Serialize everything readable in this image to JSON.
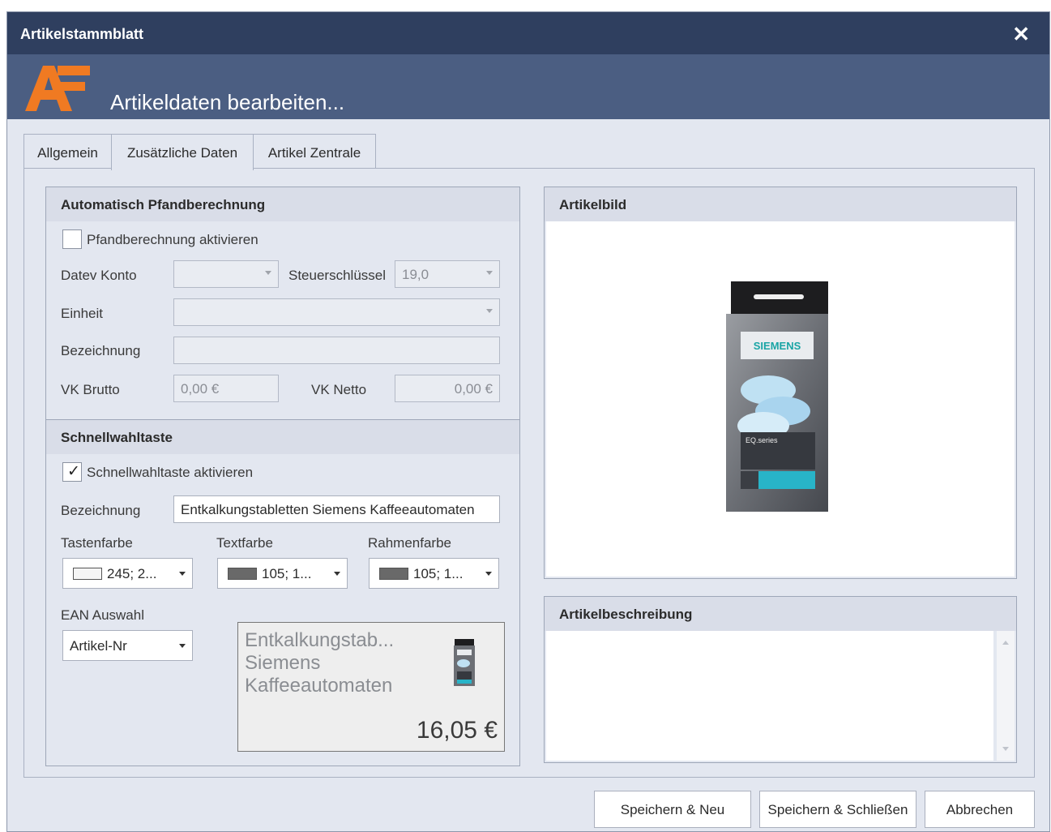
{
  "window": {
    "title": "Artikelstammblatt",
    "close_label": "✕"
  },
  "banner": {
    "subtitle": "Artikeldaten bearbeiten..."
  },
  "tabs": [
    {
      "label": "Allgemein"
    },
    {
      "label": "Zusätzliche Daten"
    },
    {
      "label": "Artikel Zentrale"
    }
  ],
  "pfand": {
    "header": "Automatisch Pfandberechnung",
    "checkbox_label": "Pfandberechnung aktivieren",
    "datev_label": "Datev Konto",
    "datev_value": "",
    "steuer_label": "Steuerschlüssel",
    "steuer_value": "19,0",
    "einheit_label": "Einheit",
    "einheit_value": "",
    "bezeichnung_label": "Bezeichnung",
    "bezeichnung_value": "",
    "vk_brutto_label": "VK Brutto",
    "vk_brutto_value": "0,00 €",
    "vk_netto_label": "VK Netto",
    "vk_netto_value": "0,00 €"
  },
  "schnell": {
    "header": "Schnellwahltaste",
    "checkbox_label": "Schnellwahltaste aktivieren",
    "checked": true,
    "bezeichnung_label": "Bezeichnung",
    "bezeichnung_value": "Entkalkungstabletten Siemens Kaffeeautomaten",
    "tastenfarbe_label": "Tastenfarbe",
    "tastenfarbe_value": "245; 2...",
    "tastenfarbe_color": "#f5f5f5",
    "textfarbe_label": "Textfarbe",
    "textfarbe_value": "105; 1...",
    "textfarbe_color": "#696969",
    "rahmenfarbe_label": "Rahmenfarbe",
    "rahmenfarbe_value": "105; 1...",
    "rahmenfarbe_color": "#696969",
    "ean_label": "EAN Auswahl",
    "ean_value": "Artikel-Nr",
    "preview_line1": "Entkalkungstab...",
    "preview_line2": "Siemens",
    "preview_line3": "Kaffeeautomaten",
    "preview_price": "16,05 €"
  },
  "artikelbild": {
    "header": "Artikelbild",
    "brand": "SIEMENS",
    "series": "EQ.series"
  },
  "beschreibung": {
    "header": "Artikelbeschreibung",
    "value": ""
  },
  "buttons": {
    "save_new": "Speichern & Neu",
    "save_close": "Speichern & Schließen",
    "cancel": "Abbrechen"
  },
  "colors": {
    "titlebar": "#2f3f5f",
    "banner": "#4b5e82",
    "logo_orange": "#f07a22"
  }
}
